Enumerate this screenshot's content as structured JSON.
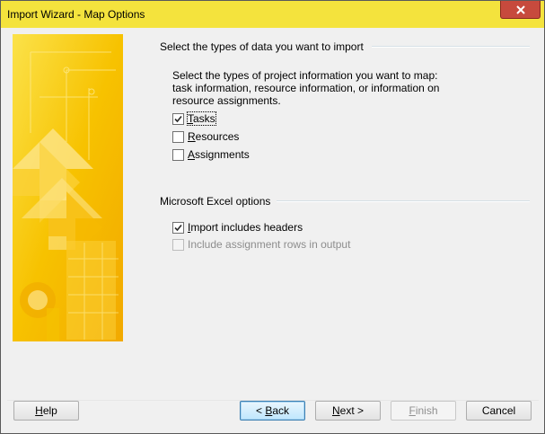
{
  "window": {
    "title": "Import Wizard - Map Options"
  },
  "section1": {
    "title": "Select the types of data you want to import",
    "description_lines": [
      "Select the types of project information you want to map:",
      "task information, resource information, or information on",
      "resource assignments."
    ],
    "checkboxes": [
      {
        "mnemonic": "T",
        "rest": "asks",
        "checked": true,
        "enabled": true
      },
      {
        "mnemonic": "R",
        "rest": "esources",
        "checked": false,
        "enabled": true
      },
      {
        "mnemonic": "A",
        "rest": "ssignments",
        "checked": false,
        "enabled": true
      }
    ]
  },
  "section2": {
    "title": "Microsoft Excel options",
    "checkboxes": [
      {
        "mnemonic": "I",
        "rest": "mport includes headers",
        "checked": true,
        "enabled": true
      },
      {
        "mnemonic": "",
        "rest": "Include assignment rows in output",
        "checked": false,
        "enabled": false
      }
    ]
  },
  "buttons": {
    "help": {
      "mnemonic": "H",
      "rest": "elp"
    },
    "back": {
      "prefix": "< ",
      "mnemonic": "B",
      "rest": "ack"
    },
    "next": {
      "mnemonic": "N",
      "rest": "ext >"
    },
    "finish": {
      "mnemonic": "F",
      "rest": "inish"
    },
    "cancel": "Cancel"
  },
  "colors": {
    "titlebar": "#f4e33d",
    "close_button": "#c74a3d",
    "banner": "#f7c500"
  },
  "icons": {
    "close": "close-icon",
    "check": "check-icon"
  }
}
